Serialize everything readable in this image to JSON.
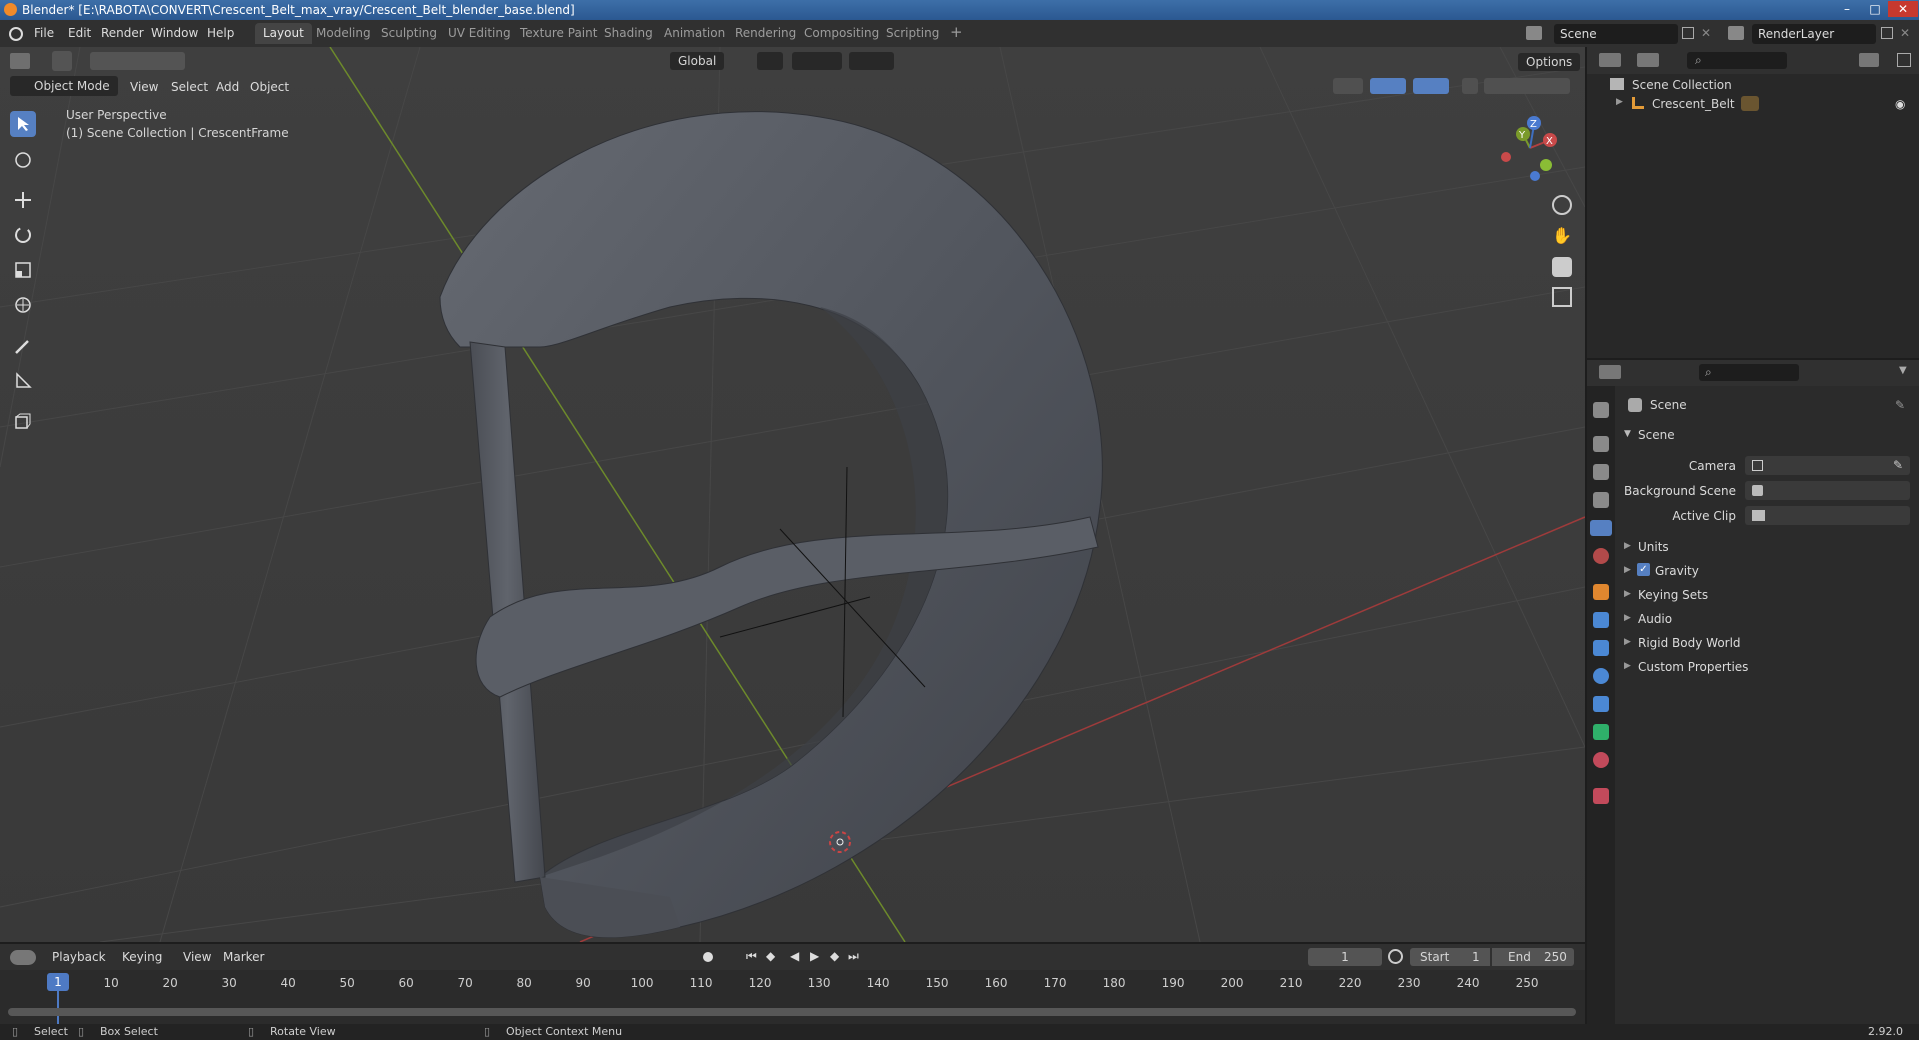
{
  "window": {
    "title": "Blender* [E:\\RABOTA\\CONVERT\\Crescent_Belt_max_vray/Crescent_Belt_blender_base.blend]"
  },
  "menu": [
    "File",
    "Edit",
    "Render",
    "Window",
    "Help"
  ],
  "workspaces": [
    "Layout",
    "Modeling",
    "Sculpting",
    "UV Editing",
    "Texture Paint",
    "Shading",
    "Animation",
    "Rendering",
    "Compositing",
    "Scripting"
  ],
  "active_workspace": "Layout",
  "scene_field": "Scene",
  "render_layer_field": "RenderLayer",
  "viewport": {
    "mode": "Object Mode",
    "header_menus": [
      "View",
      "Select",
      "Add",
      "Object"
    ],
    "orientation": "Global",
    "options_label": "Options",
    "perspective_label": "User Perspective",
    "collection_label": "(1) Scene Collection | CrescentFrame",
    "gizmo": {
      "x": "X",
      "y": "Y",
      "z": "Z"
    }
  },
  "outliner": {
    "root": "Scene Collection",
    "items": [
      "Crescent_Belt"
    ]
  },
  "properties": {
    "context_title": "Scene",
    "panel_title": "Scene",
    "fields": [
      {
        "label": "Camera"
      },
      {
        "label": "Background Scene"
      },
      {
        "label": "Active Clip"
      }
    ],
    "subpanels": [
      "Units",
      "Gravity",
      "Keying Sets",
      "Audio",
      "Rigid Body World",
      "Custom Properties"
    ],
    "gravity_checked": true
  },
  "timeline": {
    "menus": [
      "Playback",
      "Keying",
      "View",
      "Marker"
    ],
    "current_frame": "1",
    "start_label": "Start",
    "start_value": "1",
    "end_label": "End",
    "end_value": "250",
    "ruler": [
      "10",
      "20",
      "30",
      "40",
      "50",
      "60",
      "70",
      "80",
      "90",
      "100",
      "110",
      "120",
      "130",
      "140",
      "150",
      "160",
      "170",
      "180",
      "190",
      "200",
      "210",
      "220",
      "230",
      "240",
      "250"
    ],
    "playhead": "1"
  },
  "statusbar": {
    "items": [
      "Select",
      "Box Select",
      "Rotate View",
      "Object Context Menu"
    ],
    "version": "2.92.0"
  },
  "colors": {
    "accent": "#5680c2",
    "x_axis": "#b34040",
    "y_axis": "#7a9a2a",
    "object": "#575b63"
  }
}
